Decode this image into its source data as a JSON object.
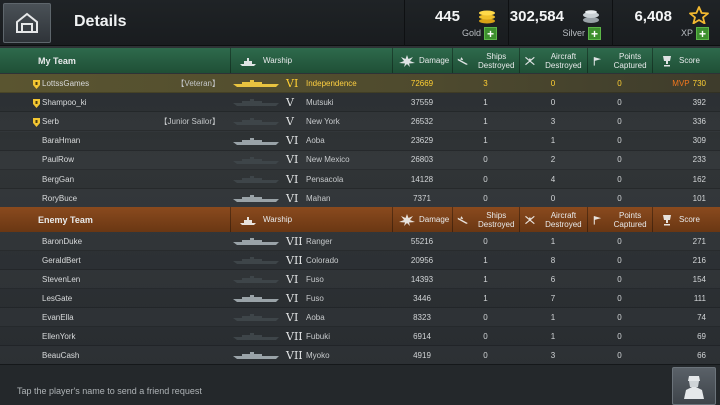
{
  "header": {
    "title": "Details",
    "gold": {
      "amount": "445",
      "label": "Gold"
    },
    "silver": {
      "amount": "302,584",
      "label": "Silver"
    },
    "xp": {
      "amount": "6,408",
      "label": "XP"
    },
    "plus": "+"
  },
  "my_team": {
    "title": "My Team",
    "columns": {
      "warship": "Warship",
      "damage": "Damage",
      "ships_destroyed": "Ships Destroyed",
      "aircraft_destroyed": "Aircraft Destroyed",
      "points_captured": "Points Captured",
      "score": "Score"
    },
    "rows": [
      {
        "player": "LottssGames",
        "rank": "【Veteran】",
        "tier": "VI",
        "ship": "Independence",
        "damage": "72669",
        "ships_destroyed": "3",
        "aircraft_destroyed": "0",
        "points_captured": "0",
        "mvp": "MVP",
        "score": "730"
      },
      {
        "player": "Shampoo_ki",
        "rank": "",
        "tier": "V",
        "ship": "Mutsuki",
        "damage": "37559",
        "ships_destroyed": "1",
        "aircraft_destroyed": "0",
        "points_captured": "0",
        "mvp": "",
        "score": "392"
      },
      {
        "player": "Serb",
        "rank": "【Junior Sailor】",
        "tier": "V",
        "ship": "New York",
        "damage": "26532",
        "ships_destroyed": "1",
        "aircraft_destroyed": "3",
        "points_captured": "0",
        "mvp": "",
        "score": "336"
      },
      {
        "player": "BaraHman",
        "rank": "",
        "tier": "VI",
        "ship": "Aoba",
        "damage": "23629",
        "ships_destroyed": "1",
        "aircraft_destroyed": "1",
        "points_captured": "0",
        "mvp": "",
        "score": "309"
      },
      {
        "player": "PaulRow",
        "rank": "",
        "tier": "VI",
        "ship": "New Mexico",
        "damage": "26803",
        "ships_destroyed": "0",
        "aircraft_destroyed": "2",
        "points_captured": "0",
        "mvp": "",
        "score": "233"
      },
      {
        "player": "BergGan",
        "rank": "",
        "tier": "VI",
        "ship": "Pensacola",
        "damage": "14128",
        "ships_destroyed": "0",
        "aircraft_destroyed": "4",
        "points_captured": "0",
        "mvp": "",
        "score": "162"
      },
      {
        "player": "RoryBuce",
        "rank": "",
        "tier": "VI",
        "ship": "Mahan",
        "damage": "7371",
        "ships_destroyed": "0",
        "aircraft_destroyed": "0",
        "points_captured": "0",
        "mvp": "",
        "score": "101"
      }
    ]
  },
  "enemy_team": {
    "title": "Enemy Team",
    "columns": {
      "warship": "Warship",
      "damage": "Damage",
      "ships_destroyed": "Ships Destroyed",
      "aircraft_destroyed": "Aircraft Destroyed",
      "points_captured": "Points Captured",
      "score": "Score"
    },
    "rows": [
      {
        "player": "BaronDuke",
        "tier": "VII",
        "ship": "Ranger",
        "damage": "55216",
        "ships_destroyed": "0",
        "aircraft_destroyed": "1",
        "points_captured": "0",
        "score": "271"
      },
      {
        "player": "GeraldBert",
        "tier": "VII",
        "ship": "Colorado",
        "damage": "20956",
        "ships_destroyed": "1",
        "aircraft_destroyed": "8",
        "points_captured": "0",
        "score": "216"
      },
      {
        "player": "StevenLen",
        "tier": "VI",
        "ship": "Fuso",
        "damage": "14393",
        "ships_destroyed": "1",
        "aircraft_destroyed": "6",
        "points_captured": "0",
        "score": "154"
      },
      {
        "player": "LesGate",
        "tier": "VI",
        "ship": "Fuso",
        "damage": "3446",
        "ships_destroyed": "1",
        "aircraft_destroyed": "7",
        "points_captured": "0",
        "score": "111"
      },
      {
        "player": "EvanElla",
        "tier": "VI",
        "ship": "Aoba",
        "damage": "8323",
        "ships_destroyed": "0",
        "aircraft_destroyed": "1",
        "points_captured": "0",
        "score": "74"
      },
      {
        "player": "EllenYork",
        "tier": "VII",
        "ship": "Fubuki",
        "damage": "6914",
        "ships_destroyed": "0",
        "aircraft_destroyed": "1",
        "points_captured": "0",
        "score": "69"
      },
      {
        "player": "BeauCash",
        "tier": "VII",
        "ship": "Myoko",
        "damage": "4919",
        "ships_destroyed": "0",
        "aircraft_destroyed": "3",
        "points_captured": "0",
        "score": "66"
      }
    ]
  },
  "footer": {
    "hint": "Tap the player's name to send a friend request"
  },
  "colors": {
    "my_team_header": "#2e6a4c",
    "enemy_team_header": "#8a4a1e",
    "highlight": "#ffcf33",
    "mvp": "#f0761e"
  }
}
